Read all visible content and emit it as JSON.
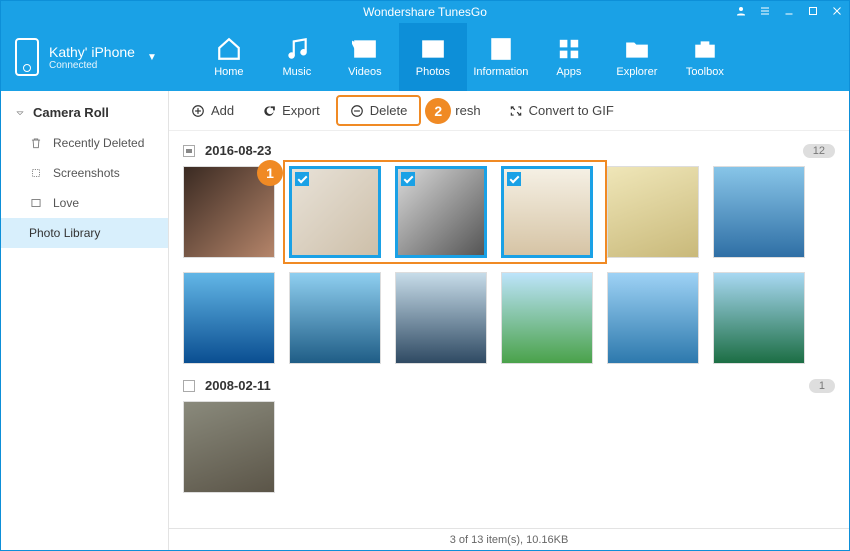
{
  "app_title": "Wondershare TunesGo",
  "device": {
    "name": "Kathy' iPhone",
    "status": "Connected"
  },
  "nav": {
    "home": "Home",
    "music": "Music",
    "videos": "Videos",
    "photos": "Photos",
    "information": "Information",
    "apps": "Apps",
    "explorer": "Explorer",
    "toolbox": "Toolbox",
    "active": "photos"
  },
  "sidebar": {
    "header": "Camera Roll",
    "items": [
      {
        "label": "Recently Deleted"
      },
      {
        "label": "Screenshots"
      },
      {
        "label": "Love"
      },
      {
        "label": "Photo Library",
        "active": true
      }
    ]
  },
  "toolbar": {
    "add": "Add",
    "export": "Export",
    "delete": "Delete",
    "refresh_fragment": "resh",
    "convert": "Convert to GIF"
  },
  "callouts": {
    "one": "1",
    "two": "2"
  },
  "groups": [
    {
      "date": "2016-08-23",
      "count": "12",
      "indeterminate": true,
      "photos": 12,
      "selected_indices": [
        1,
        2,
        3
      ]
    },
    {
      "date": "2008-02-11",
      "count": "1",
      "indeterminate": false,
      "photos": 1,
      "selected_indices": []
    }
  ],
  "status_text": "3 of 13 item(s), 10.16KB"
}
